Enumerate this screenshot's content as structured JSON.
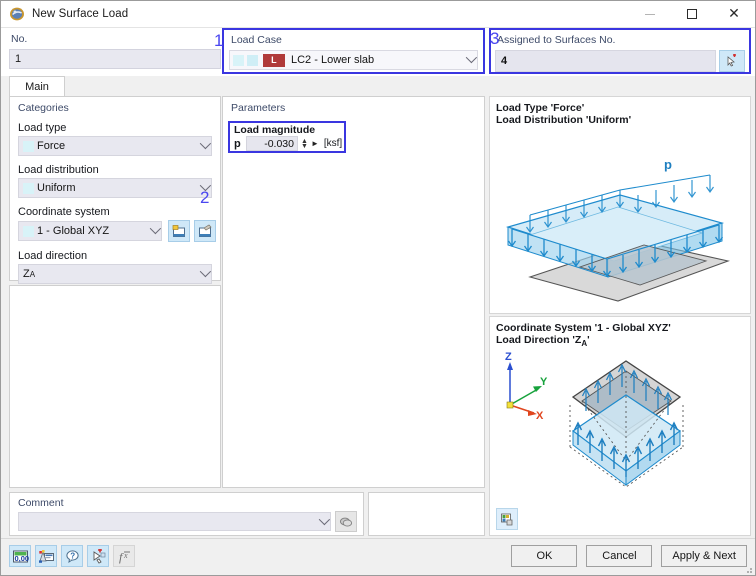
{
  "window": {
    "title": "New Surface Load",
    "icon": "surface-load-icon",
    "controls": {
      "minimize": "minimize",
      "maximize": "maximize",
      "close": "close"
    }
  },
  "annotations": [
    {
      "id": "1",
      "label": "1",
      "target": "load-case"
    },
    {
      "id": "2",
      "label": "2",
      "target": "load-magnitude"
    },
    {
      "id": "3",
      "label": "3",
      "target": "assigned-surfaces"
    }
  ],
  "header": {
    "number": {
      "label": "No.",
      "value": "1"
    },
    "load_case": {
      "label": "Load Case",
      "badge": "L",
      "value": "LC2 - Lower slab",
      "dropdown_icon": "chevron-down-icon"
    },
    "assigned": {
      "label": "Assigned to Surfaces No.",
      "value": "4",
      "pick_icon": "select-surfaces-icon"
    }
  },
  "tabs": [
    {
      "label": "Main",
      "active": true
    }
  ],
  "categories": {
    "group_label": "Categories",
    "fields": [
      {
        "label": "Load type",
        "value": "Force"
      },
      {
        "label": "Load distribution",
        "value": "Uniform"
      },
      {
        "label": "Coordinate system",
        "value": "1 - Global XYZ"
      },
      {
        "label": "Load direction",
        "value": "Z",
        "subscript": "A"
      }
    ],
    "coord_buttons": [
      {
        "name": "new-coordinate-system-icon"
      },
      {
        "name": "edit-coordinate-system-icon"
      }
    ]
  },
  "parameters": {
    "group_label": "Parameters",
    "magnitude": {
      "label": "Load magnitude",
      "symbol": "p",
      "value": "-0.030",
      "unit": "[ksf]",
      "spinner_up": "▲",
      "spinner_down": "▼",
      "more_icon": "►"
    }
  },
  "preview": {
    "top": {
      "line1": "Load Type 'Force'",
      "line2": "Load Distribution 'Uniform'",
      "load_symbol": "p"
    },
    "bottom": {
      "line1": "Coordinate System '1 - Global XYZ'",
      "line2_prefix": "Load Direction 'Z",
      "line2_sub": "A",
      "line2_suffix": "'",
      "axes": {
        "z": "Z",
        "y": "Y",
        "x": "X"
      },
      "image_button": "preview-image-icon"
    }
  },
  "comment": {
    "label": "Comment",
    "value": "",
    "dropdown_icon": "chevron-down-icon",
    "button_icon": "comment-list-icon"
  },
  "footer": {
    "toolbar": [
      {
        "name": "units-icon",
        "enabled": true
      },
      {
        "name": "settings-icon",
        "enabled": true
      },
      {
        "name": "help-icon",
        "enabled": true
      },
      {
        "name": "render-icon",
        "enabled": true
      },
      {
        "name": "formula-icon",
        "enabled": false
      }
    ],
    "buttons": [
      {
        "label": "OK",
        "name": "ok-button"
      },
      {
        "label": "Cancel",
        "name": "cancel-button"
      },
      {
        "label": "Apply & Next",
        "name": "apply-next-button"
      }
    ]
  },
  "colors": {
    "highlight": "#3a36e0",
    "annotation": "#4a47f0",
    "accent_blue": "#1e8bcd",
    "load_case_badge": "#b03a3a"
  }
}
